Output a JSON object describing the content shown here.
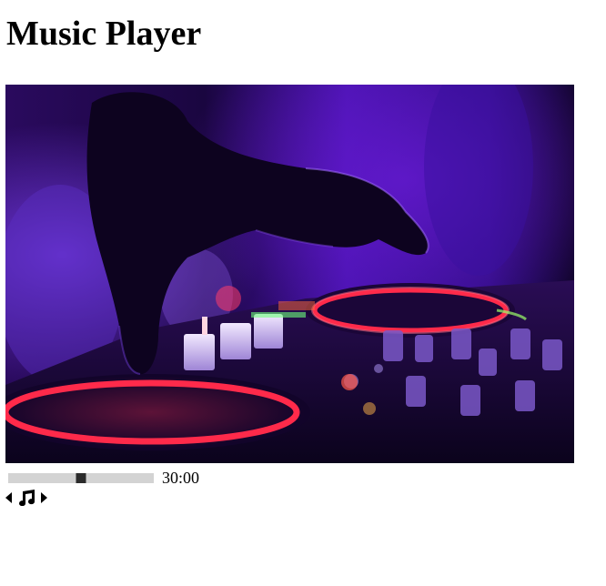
{
  "page": {
    "title": "Music Player"
  },
  "cover": {
    "alt": "DJ hand on a mixing deck with glowing red jog wheel under purple light"
  },
  "player": {
    "progress_fraction": 0.5,
    "time_text": "30:00"
  },
  "controls": {
    "previous_icon": "caret-left-icon",
    "play_icon": "music-note-icon",
    "next_icon": "caret-right-icon"
  },
  "colors": {
    "track": "#d3d3d3",
    "handle": "#2b2b2b",
    "cover_base": "#0a0320",
    "neon_red": "#ff2a4a",
    "purple_glow": "#6a1bd8"
  }
}
